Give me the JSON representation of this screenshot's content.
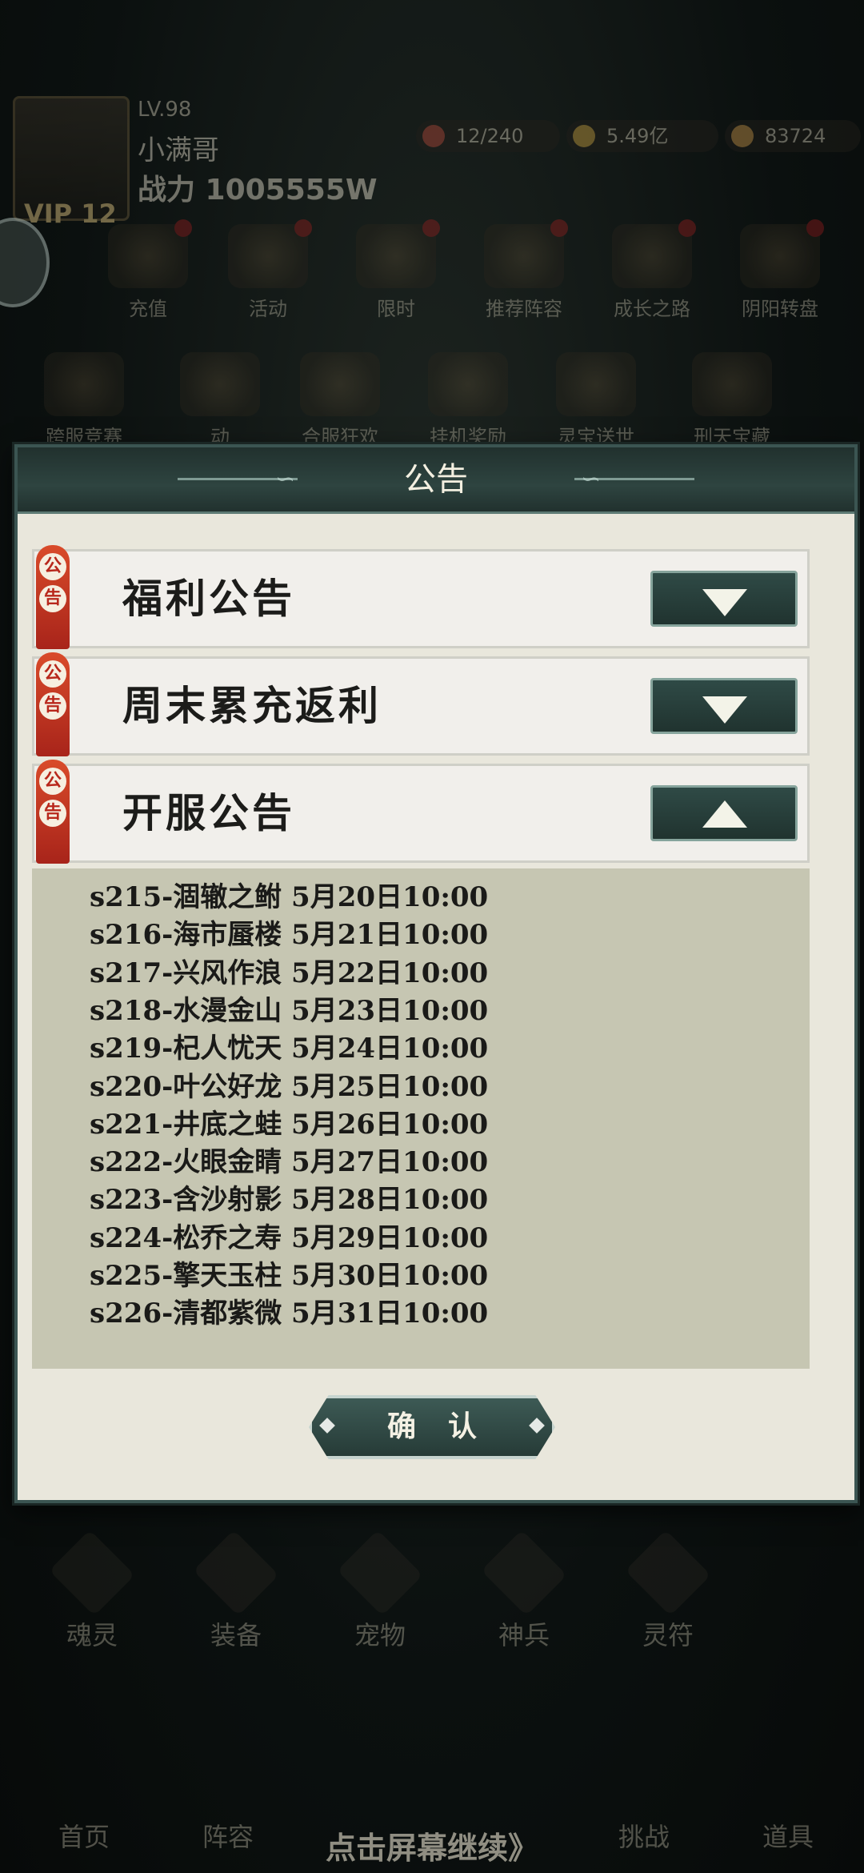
{
  "player": {
    "level": "LV.98",
    "name": "小满哥",
    "power": "战力 1005555W",
    "vip": "VIP 12"
  },
  "resources": [
    {
      "value": "12/240",
      "color": "#b44a3a"
    },
    {
      "value": "5.49亿",
      "color": "#c8a040"
    },
    {
      "value": "83724",
      "color": "#c9964a"
    }
  ],
  "grid_row1": [
    "充值",
    "活动",
    "限时",
    "推荐阵容",
    "成长之路",
    "阴阳转盘"
  ],
  "grid_row2": [
    "跨服竞赛",
    "动",
    "合服狂欢",
    "挂机奖励",
    "灵宝送世",
    "刑天宝藏"
  ],
  "modal": {
    "title": "公告",
    "badge_text": [
      "公",
      "告"
    ],
    "sections": [
      {
        "title": "福利公告",
        "expanded": false
      },
      {
        "title": "周末累充返利",
        "expanded": false
      },
      {
        "title": "开服公告",
        "expanded": true
      }
    ],
    "lines": [
      "s215-涸辙之鲋 5月20日10:00",
      "s216-海市蜃楼 5月21日10:00",
      "s217-兴风作浪 5月22日10:00",
      "s218-水漫金山 5月23日10:00",
      "s219-杞人忧天 5月24日10:00",
      "s220-叶公好龙 5月25日10:00",
      "s221-井底之蛙 5月26日10:00",
      "s222-火眼金睛 5月27日10:00",
      "s223-含沙射影 5月28日10:00",
      "s224-松乔之寿 5月29日10:00",
      "s225-擎天玉柱 5月30日10:00",
      "s226-清都紫微 5月31日10:00"
    ],
    "confirm_label": "确认"
  },
  "bottom_upper": [
    "魂灵",
    "装备",
    "宠物",
    "神兵",
    "灵符"
  ],
  "bottom_lower": [
    "首页",
    "阵容",
    "挑战",
    "道具"
  ],
  "hint": "点击屏幕继续》"
}
